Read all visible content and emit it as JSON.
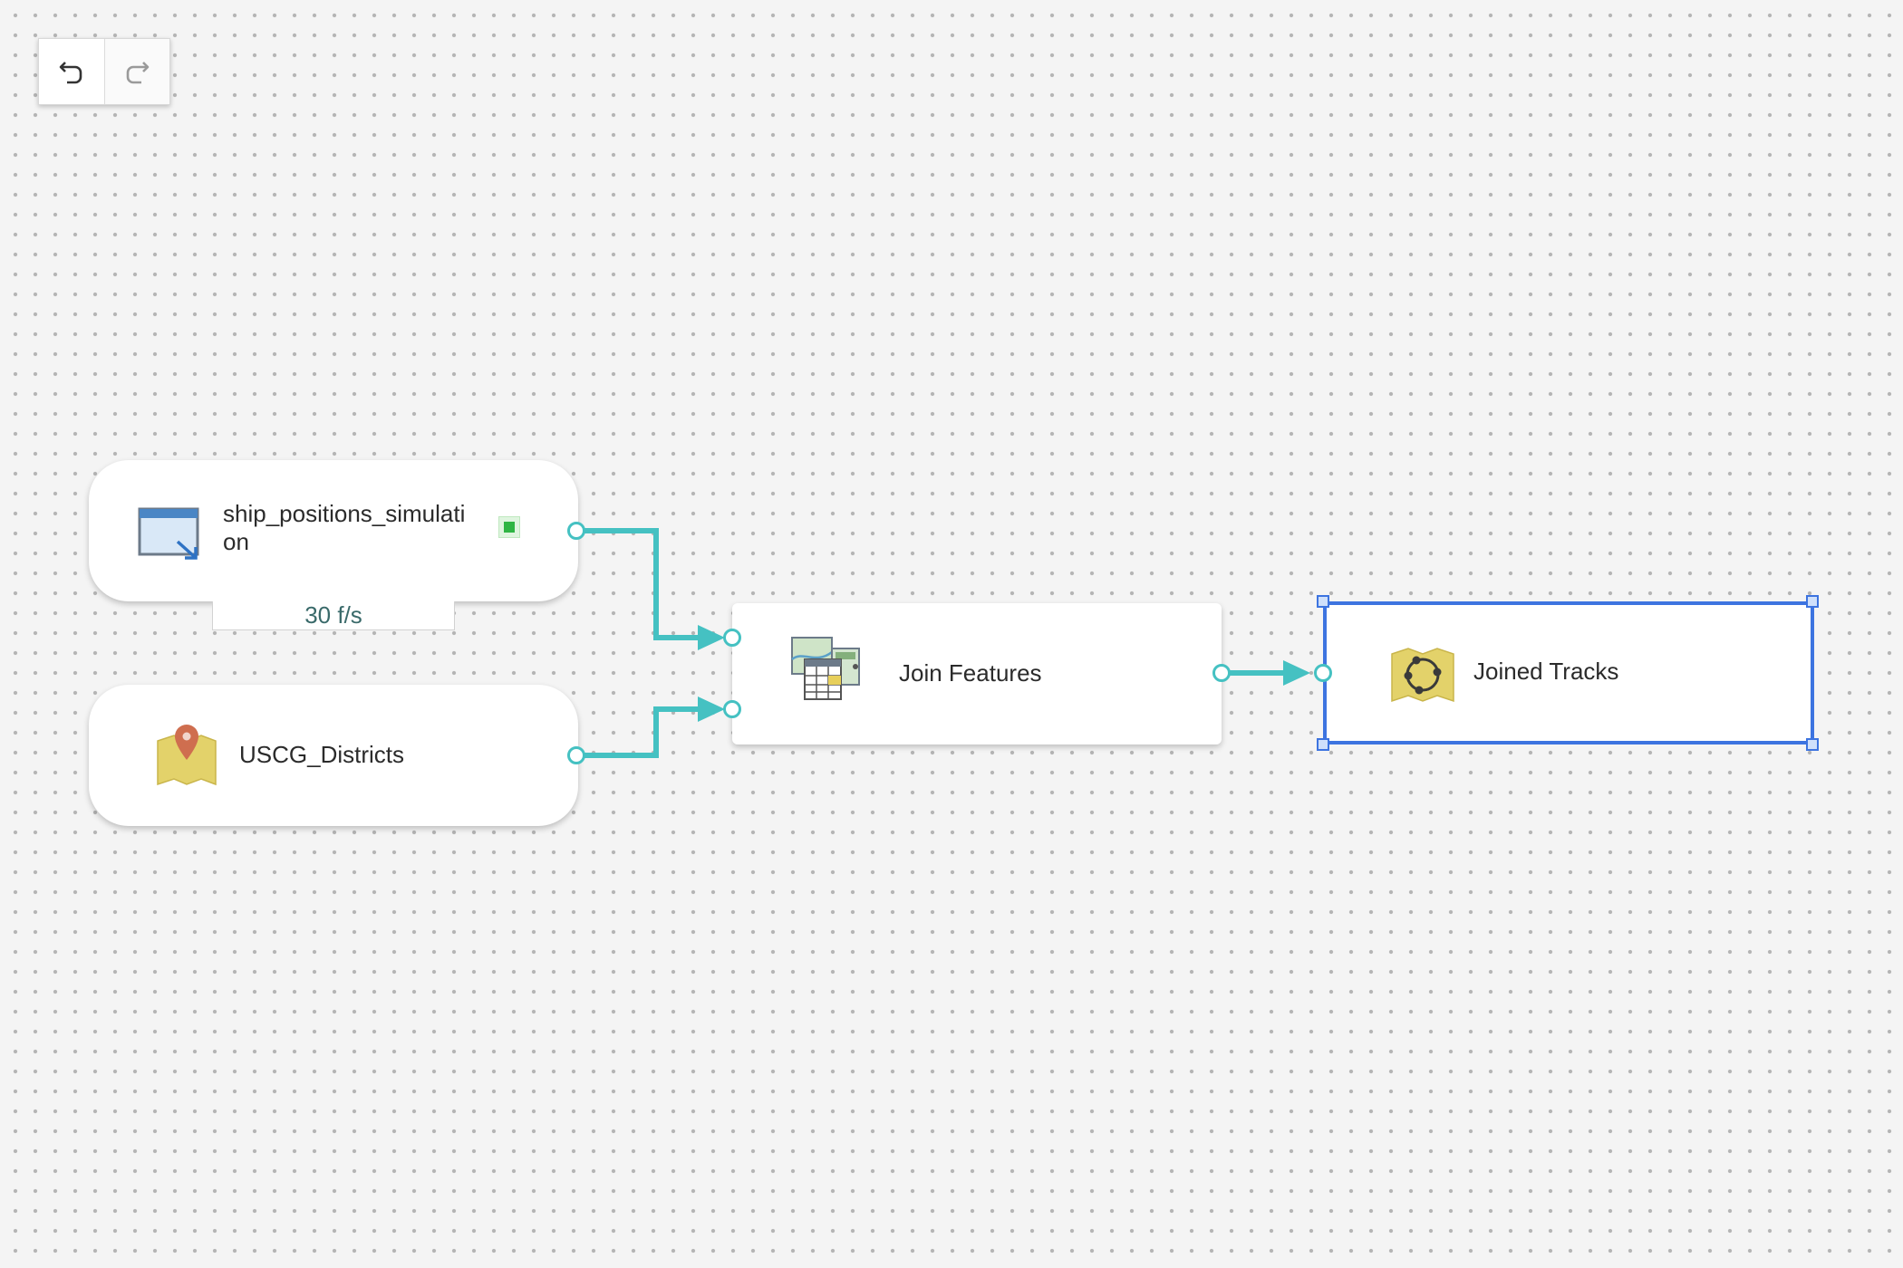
{
  "toolbar": {
    "undo": {
      "icon": "undo-icon",
      "enabled": true
    },
    "redo": {
      "icon": "redo-icon",
      "enabled": false
    }
  },
  "nodes": {
    "source_ship": {
      "label": "ship_positions_simulati\non",
      "icon": "feed-window-icon",
      "status": "running",
      "rate": "30 f/s"
    },
    "source_districts": {
      "label": "USCG_Districts",
      "icon": "map-pin-layer-icon"
    },
    "tool_join": {
      "label": "Join Features",
      "icon": "join-features-icon"
    },
    "output_tracks": {
      "label": "Joined Tracks",
      "icon": "feature-layer-output-icon",
      "selected": true
    }
  },
  "connections": [
    {
      "from": "source_ship",
      "to": "tool_join"
    },
    {
      "from": "source_districts",
      "to": "tool_join"
    },
    {
      "from": "tool_join",
      "to": "output_tracks"
    }
  ],
  "colors": {
    "connector": "#45c1c2",
    "selection": "#3d74e0",
    "status_running": "#2fb544",
    "layer_yellow": "#e3d26a"
  }
}
